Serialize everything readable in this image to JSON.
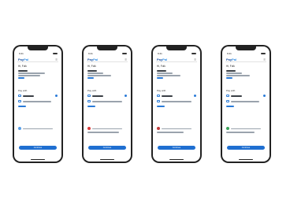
{
  "screens": [
    {
      "time": "9:41",
      "logo_pay": "Pay",
      "logo_pal": "Pal",
      "greeting": "Hi, Folk",
      "flag_color": "#5aa0e8",
      "continue_label": "Continue"
    },
    {
      "time": "9:41",
      "logo_pay": "Pay",
      "logo_pal": "Pal",
      "greeting": "Hi, Folk",
      "flag_color": "#d93a3a",
      "continue_label": "Continue"
    },
    {
      "time": "9:41",
      "logo_pay": "Pay",
      "logo_pal": "Pal",
      "greeting": "Hi, Folk",
      "flag_color": "#c23b3b",
      "continue_label": "Continue"
    },
    {
      "time": "9:41",
      "logo_pay": "Pay",
      "logo_pal": "Pal",
      "greeting": "Hi, Folk",
      "flag_color": "#3aa35a",
      "continue_label": "Continue"
    }
  ],
  "payment_heading": "Pay with"
}
